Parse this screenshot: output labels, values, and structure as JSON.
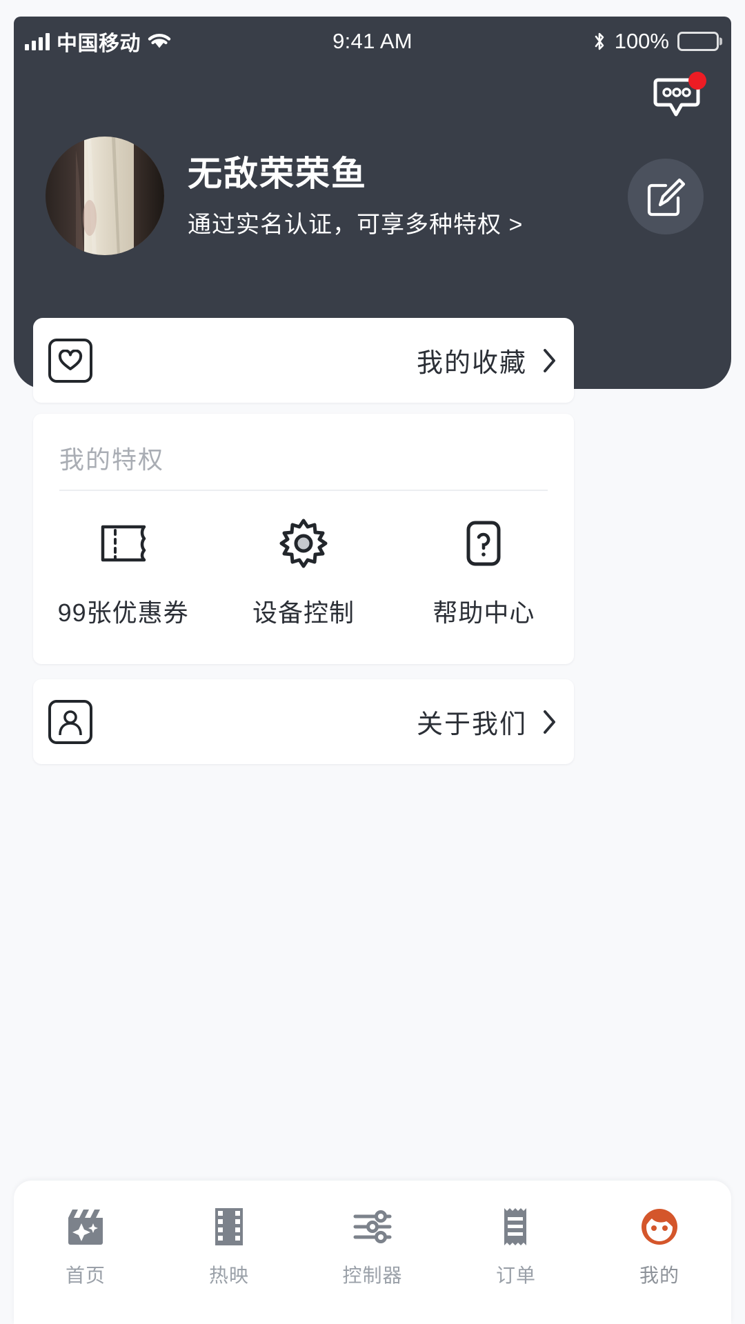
{
  "status_bar": {
    "carrier": "中国移动",
    "time": "9:41 AM",
    "battery_percent": "100%",
    "signal_icon": "signal-bars-icon",
    "wifi_icon": "wifi-icon",
    "bluetooth_icon": "bluetooth-icon",
    "battery_icon": "battery-full-icon"
  },
  "header": {
    "message_icon": "message-bubble-icon",
    "has_unread_badge": true,
    "badge_color": "#ed1c24",
    "background_color": "#393e48",
    "edit_icon": "edit-pencil-icon",
    "avatar_name": "user-avatar"
  },
  "profile": {
    "username": "无敌荣荣鱼",
    "verification_text": "通过实名认证，可享多种特权 >"
  },
  "favorites": {
    "icon": "heart-icon",
    "label": "我的收藏",
    "chevron": "chevron-right-icon"
  },
  "privileges": {
    "title": "我的特权",
    "items": [
      {
        "icon": "coupon-ticket-icon",
        "label": "99张优惠券"
      },
      {
        "icon": "gear-icon",
        "label": "设备控制"
      },
      {
        "icon": "question-mark-icon",
        "label": "帮助中心"
      }
    ]
  },
  "about": {
    "icon": "person-icon",
    "label": "关于我们",
    "chevron": "chevron-right-icon"
  },
  "tabbar": {
    "active_color": "#d4562b",
    "inactive_color": "#7c828b",
    "items": [
      {
        "icon": "clapperboard-icon",
        "label": "首页",
        "active": false
      },
      {
        "icon": "film-strip-icon",
        "label": "热映",
        "active": false
      },
      {
        "icon": "sliders-icon",
        "label": "控制器",
        "active": false
      },
      {
        "icon": "receipt-icon",
        "label": "订单",
        "active": false
      },
      {
        "icon": "face-avatar-icon",
        "label": "我的",
        "active": true
      }
    ]
  }
}
